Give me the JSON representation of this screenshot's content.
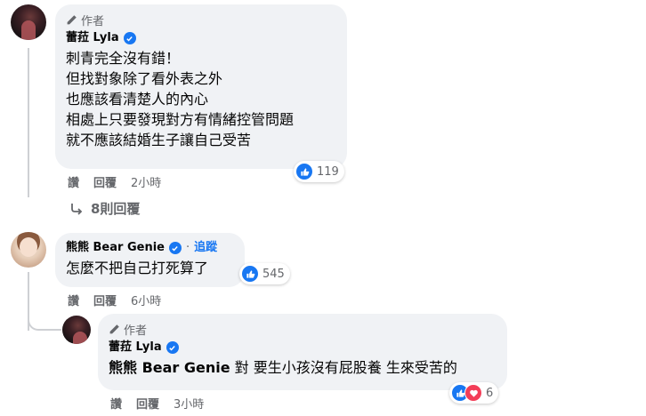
{
  "comment1": {
    "author_tag": "作者",
    "name": "蕾菈 Lyla",
    "lines": [
      "刺青完全沒有錯！",
      "但找對象除了看外表之外",
      "也應該看清楚人的內心",
      "相處上只要發現對方有情緒控管問題",
      "就不應該結婚生子讓自己受苦"
    ],
    "reaction_count": "119",
    "actions": {
      "like": "讚",
      "reply": "回覆",
      "time": "2小時"
    },
    "replies_link": "8則回覆"
  },
  "comment2": {
    "name": "熊熊 Bear Genie",
    "separator": "·",
    "follow": "追蹤",
    "text": "怎麼不把自己打死算了",
    "reaction_count": "545",
    "actions": {
      "like": "讚",
      "reply": "回覆",
      "time": "6小時"
    }
  },
  "reply1": {
    "author_tag": "作者",
    "name": "蕾菈 Lyla",
    "mention": "熊熊 Bear Genie",
    "text": " 對 要生小孩沒有屁股養 生來受苦的",
    "reaction_count": "6",
    "actions": {
      "like": "讚",
      "reply": "回覆",
      "time": "3小時"
    }
  },
  "icons": {
    "author": "pencil-icon",
    "verified": "verified-badge-icon",
    "like": "thumbs-up-icon",
    "love": "heart-icon",
    "reply_arrow": "reply-arrow-icon"
  },
  "colors": {
    "bubble": "#f0f2f5",
    "link": "#1877f2",
    "love": "#f33e58",
    "meta": "#65676b"
  }
}
